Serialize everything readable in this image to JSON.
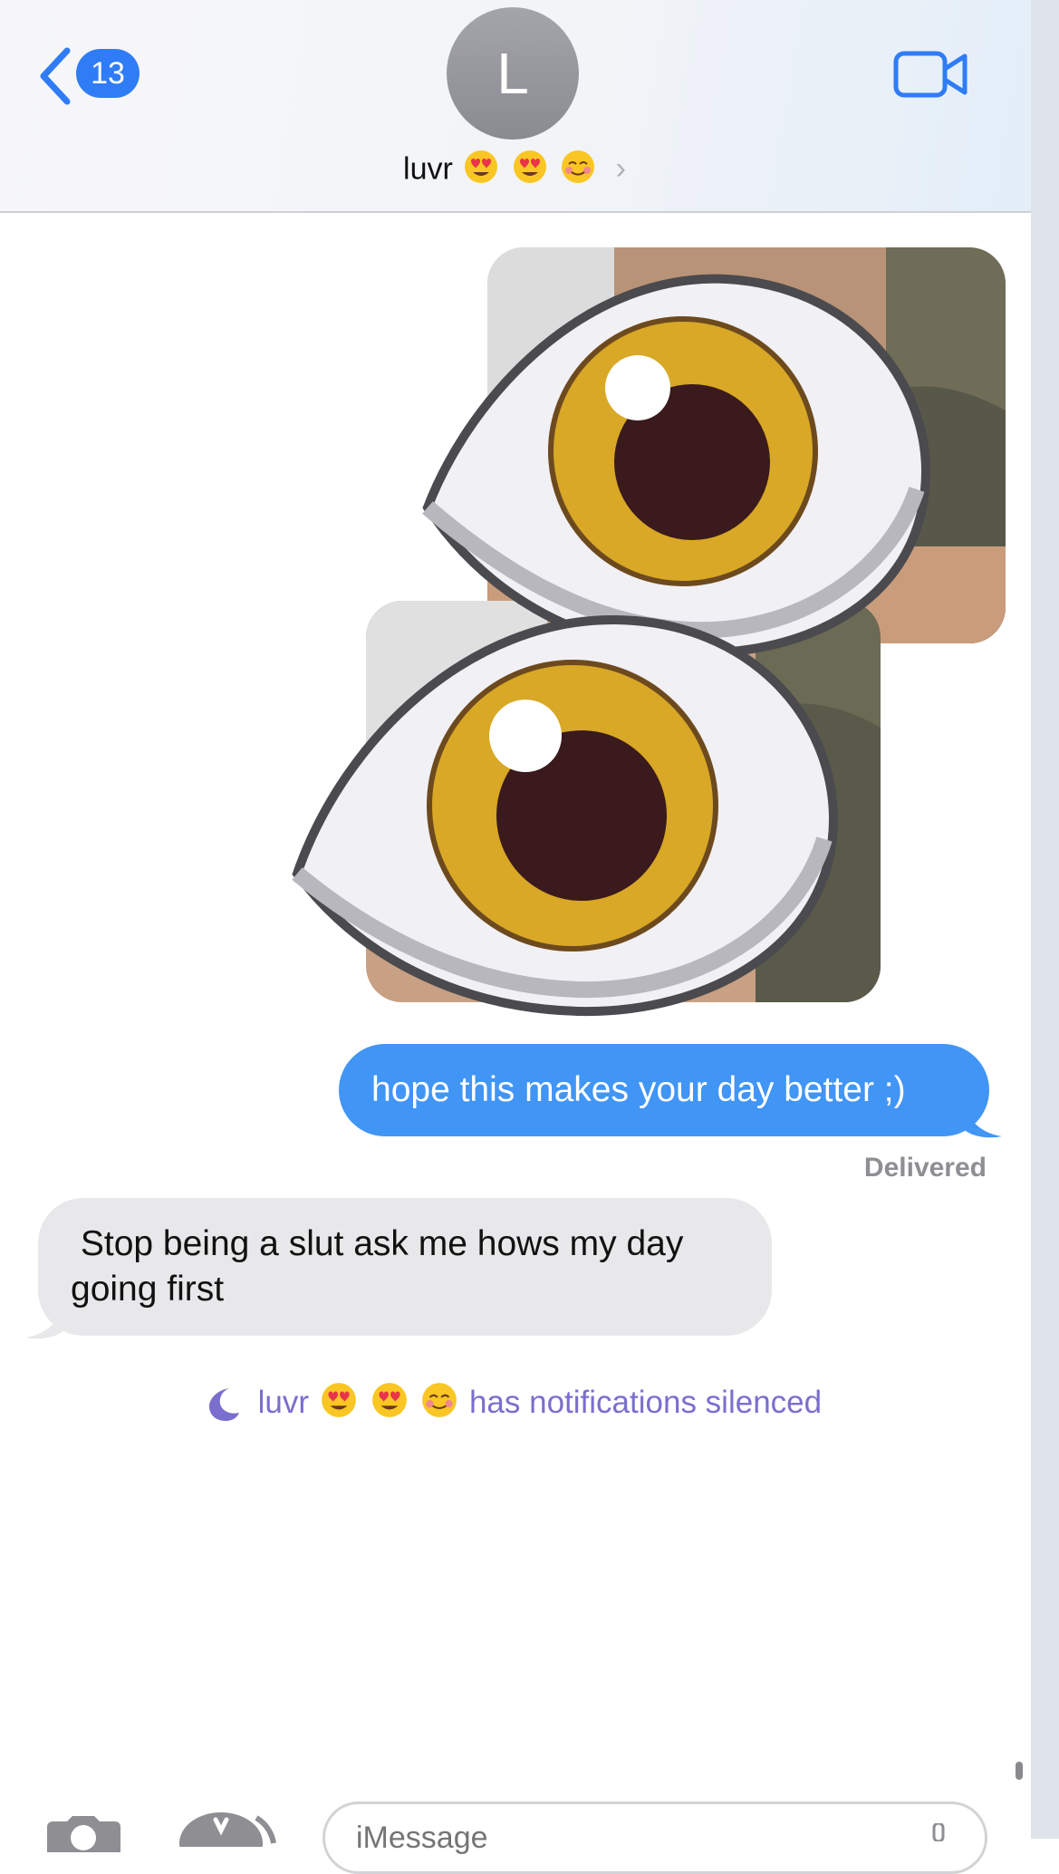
{
  "header": {
    "unread_count": "13",
    "avatar_initial": "L",
    "contact_name": "luvr",
    "contact_emojis": [
      "😍",
      "😍",
      "☺️"
    ]
  },
  "messages": {
    "outgoing_text": "hope this makes your day better ;)",
    "status": "Delivered",
    "incoming_text": " Stop being a slut ask me hows my day\ngoing first"
  },
  "notice": {
    "name": "luvr",
    "emojis": [
      "😍",
      "😍",
      "☺️"
    ],
    "text": "has notifications silenced"
  },
  "composer": {
    "placeholder": "iMessage"
  },
  "colors": {
    "accent": "#2f7cf6",
    "outgoing_bubble": "#4195f5",
    "incoming_bubble": "#e8e8eb",
    "silenced_text": "#7a6fce"
  },
  "icons": [
    "chevron-left-icon",
    "video-camera-icon",
    "eye-emoji",
    "moon-icon",
    "camera-icon",
    "app-store-icon",
    "microphone-icon"
  ]
}
